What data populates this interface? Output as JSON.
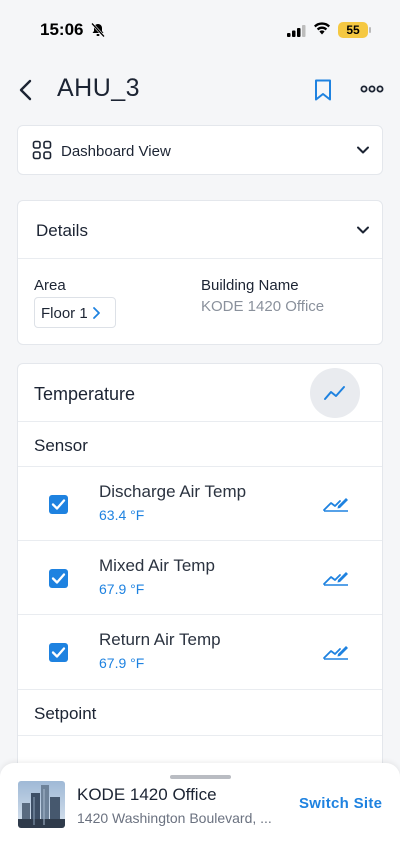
{
  "status_bar": {
    "time": "15:06",
    "battery": "55"
  },
  "header": {
    "title": "AHU_3"
  },
  "dashboard_view": {
    "label": "Dashboard View"
  },
  "details": {
    "title": "Details",
    "area_label": "Area",
    "area_value": "Floor 1",
    "building_label": "Building Name",
    "building_value": "KODE 1420 Office"
  },
  "temperature": {
    "title": "Temperature",
    "sensor_section": "Sensor",
    "sensors": [
      {
        "name": "Discharge Air Temp",
        "value": "63.4 °F",
        "checked": true
      },
      {
        "name": "Mixed Air Temp",
        "value": "67.9 °F",
        "checked": true
      },
      {
        "name": "Return Air Temp",
        "value": "67.9 °F",
        "checked": true
      }
    ],
    "setpoint_section": "Setpoint"
  },
  "site": {
    "name": "KODE 1420 Office",
    "address": "1420 Washington Boulevard, ...",
    "switch_label": "Switch Site"
  },
  "colors": {
    "accent": "#1e82e0",
    "battery": "#f5c842"
  }
}
